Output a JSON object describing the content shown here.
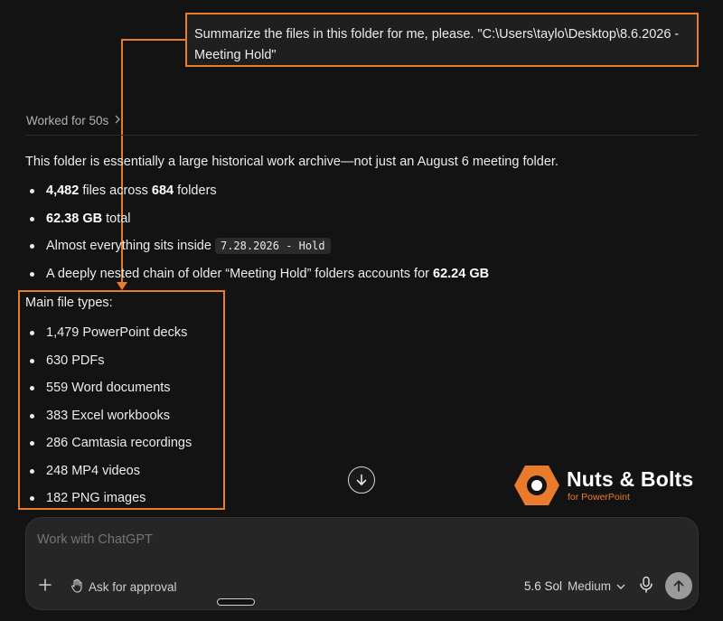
{
  "user_message": "Summarize the files in this folder for me, please. \"C:\\Users\\taylo\\Desktop\\8.6.2026 - Meeting Hold\"",
  "worked": {
    "label": "Worked for 50s",
    "chevron": "chevron-right-icon"
  },
  "intro": "This folder is essentially a large historical work archive—not just an August 6 meeting folder.",
  "facts": [
    {
      "bold": "4,482",
      "mid": " files across ",
      "bold2": "684",
      "end": " folders"
    },
    {
      "bold": "62.38 GB",
      "end": " total"
    },
    {
      "text": "Almost everything sits inside ",
      "code": "7.28.2026 - Hold"
    },
    {
      "text": "A deeply nested chain of older “Meeting Hold” folders accounts for ",
      "bold": "62.24 GB"
    }
  ],
  "types_heading": "Main file types:",
  "file_types": [
    "1,479 PowerPoint decks",
    "630 PDFs",
    "559 Word documents",
    "383 Excel workbooks",
    "286 Camtasia recordings",
    "248 MP4 videos",
    "182 PNG images"
  ],
  "logo": {
    "name": "Nuts & Bolts",
    "tagline": "for PowerPoint",
    "color": "#ea7b2c"
  },
  "composer": {
    "placeholder": "Work with ChatGPT",
    "approval_label": "Ask for approval",
    "model_name": "5.6 Sol",
    "model_effort": "Medium"
  },
  "icons": {
    "plus": "plus-icon",
    "approval": "hand-icon",
    "model_chevron": "chevron-down-icon",
    "mic": "microphone-icon",
    "send": "arrow-up-icon",
    "scroll": "arrow-down-icon"
  },
  "colors": {
    "accent": "#ea7b2c",
    "background": "#131313",
    "composer": "#262626"
  }
}
